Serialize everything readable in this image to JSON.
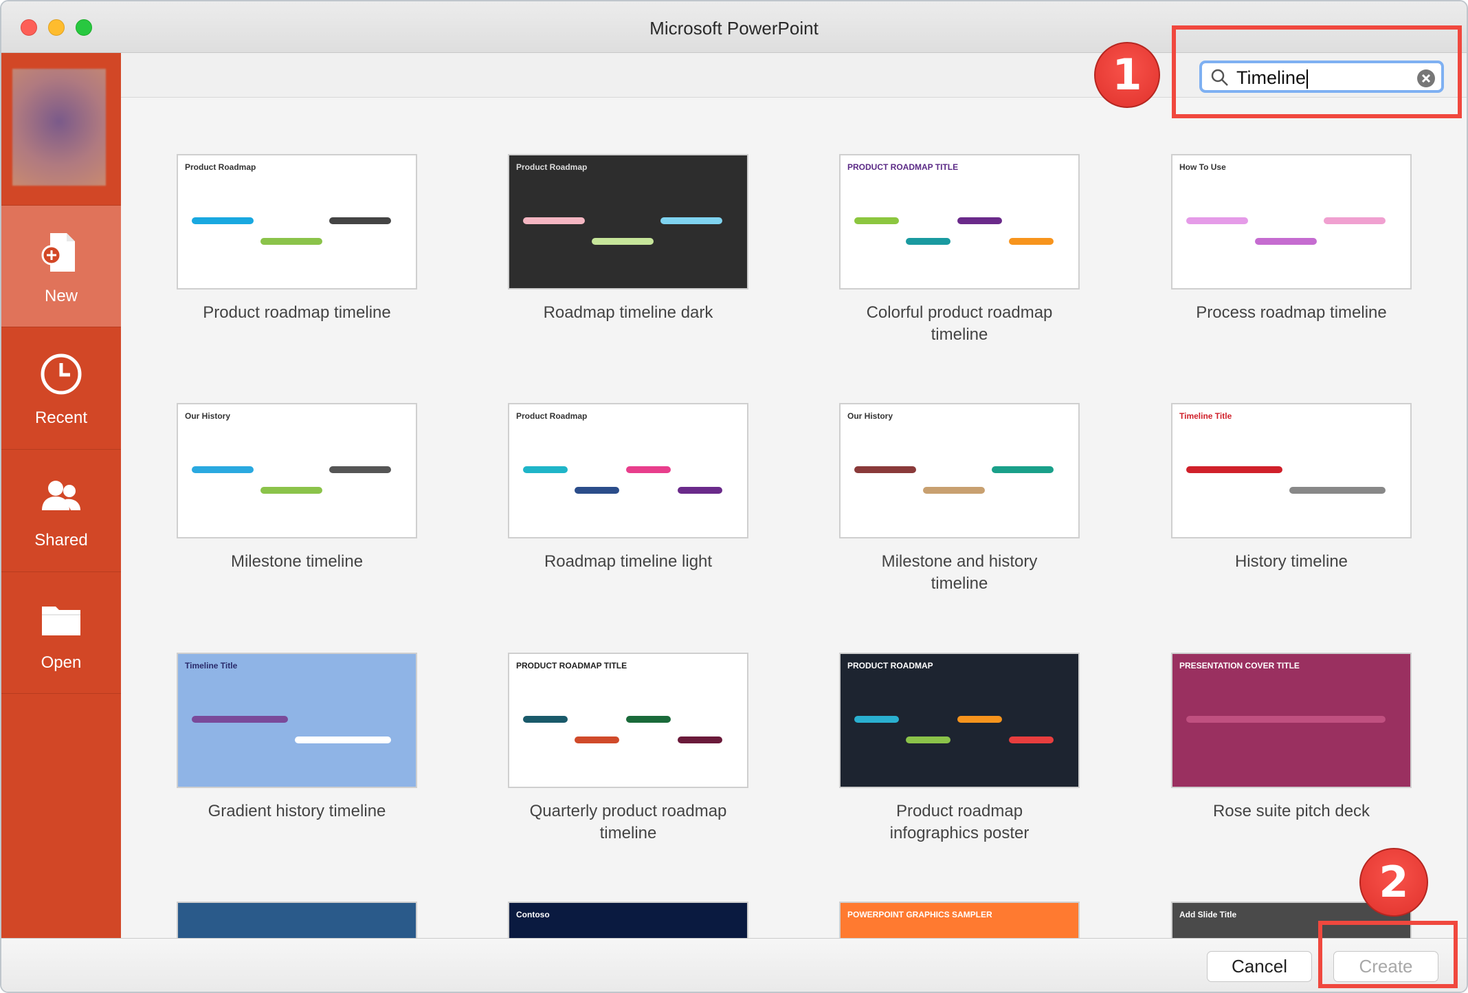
{
  "window": {
    "title": "Microsoft PowerPoint"
  },
  "sidebar": {
    "items": [
      {
        "label": "New",
        "icon": "new-document-icon"
      },
      {
        "label": "Recent",
        "icon": "clock-icon"
      },
      {
        "label": "Shared",
        "icon": "people-icon"
      },
      {
        "label": "Open",
        "icon": "folder-icon"
      }
    ]
  },
  "search": {
    "value": "Timeline"
  },
  "templates": [
    {
      "name": "Product roadmap timeline",
      "header": "Product Roadmap",
      "bg": "#ffffff",
      "fg": "#333333",
      "accents": [
        "#19a8e0",
        "#8bc34a",
        "#444444"
      ]
    },
    {
      "name": "Roadmap timeline dark",
      "header": "Product Roadmap",
      "bg": "#2d2d2d",
      "fg": "#dddddd",
      "accents": [
        "#f4b6c2",
        "#c6e59a",
        "#7fd3f0"
      ]
    },
    {
      "name": "Colorful product roadmap timeline",
      "header": "PRODUCT ROADMAP TITLE",
      "bg": "#ffffff",
      "fg": "#5b2a86",
      "accents": [
        "#8cc63f",
        "#1a9aa0",
        "#6a2a8a",
        "#f7941d"
      ]
    },
    {
      "name": "Process roadmap timeline",
      "header": "How To Use",
      "bg": "#ffffff",
      "fg": "#333333",
      "accents": [
        "#e59be8",
        "#c56cd0",
        "#f0a0d0"
      ]
    },
    {
      "name": "Milestone timeline",
      "header": "Our History",
      "bg": "#ffffff",
      "fg": "#333333",
      "accents": [
        "#2aa9e0",
        "#8bc34a",
        "#555555"
      ]
    },
    {
      "name": "Roadmap timeline light",
      "header": "Product Roadmap",
      "bg": "#ffffff",
      "fg": "#333333",
      "accents": [
        "#1fb5c8",
        "#2b4d8a",
        "#e83e8c",
        "#6a2a8a"
      ]
    },
    {
      "name": "Milestone and history timeline",
      "header": "Our History",
      "bg": "#ffffff",
      "fg": "#333333",
      "accents": [
        "#8a3a3a",
        "#c8a070",
        "#1aa08a"
      ]
    },
    {
      "name": "History timeline",
      "header": "Timeline Title",
      "bg": "#ffffff",
      "fg": "#d0202a",
      "accents": [
        "#d0202a",
        "#888888"
      ]
    },
    {
      "name": "Gradient history timeline",
      "header": "Timeline Title",
      "bg": "#8fb4e6",
      "fg": "#2a2a6a",
      "accents": [
        "#7a4a9a",
        "#ffffff"
      ]
    },
    {
      "name": "Quarterly product roadmap timeline",
      "header": "PRODUCT ROADMAP TITLE",
      "bg": "#ffffff",
      "fg": "#222222",
      "accents": [
        "#1a5a6a",
        "#d04a2a",
        "#1a6a3a",
        "#6a1a3a"
      ]
    },
    {
      "name": "Product roadmap infographics poster",
      "header": "PRODUCT ROADMAP",
      "bg": "#1d2430",
      "fg": "#ffffff",
      "accents": [
        "#2ab0d0",
        "#8bc34a",
        "#f7941d",
        "#e83e3e"
      ]
    },
    {
      "name": "Rose suite pitch deck",
      "header": "PRESENTATION COVER TITLE",
      "bg": "#9a3060",
      "fg": "#ffffff",
      "accents": [
        "#c05080"
      ]
    },
    {
      "name": "",
      "header": "",
      "bg": "#2a5a8a",
      "fg": "#ffffff",
      "accents": [
        "#8ab0d0"
      ]
    },
    {
      "name": "",
      "header": "Contoso",
      "bg": "#0a1a40",
      "fg": "#ffffff",
      "accents": [
        "#2a70e0",
        "#e04040"
      ]
    },
    {
      "name": "",
      "header": "POWERPOINT GRAPHICS SAMPLER",
      "bg": "#ff7a30",
      "fg": "#ffffff",
      "accents": [
        "#7fa0c8"
      ]
    },
    {
      "name": "",
      "header": "Add Slide Title",
      "bg": "#4a4a4a",
      "fg": "#ffffff",
      "accents": [
        "#666666"
      ]
    }
  ],
  "footer": {
    "cancel": "Cancel",
    "create": "Create"
  },
  "annotations": {
    "step1": "1",
    "step2": "2"
  },
  "colors": {
    "sidebar": "#d24726",
    "highlight": "#f0483e"
  }
}
